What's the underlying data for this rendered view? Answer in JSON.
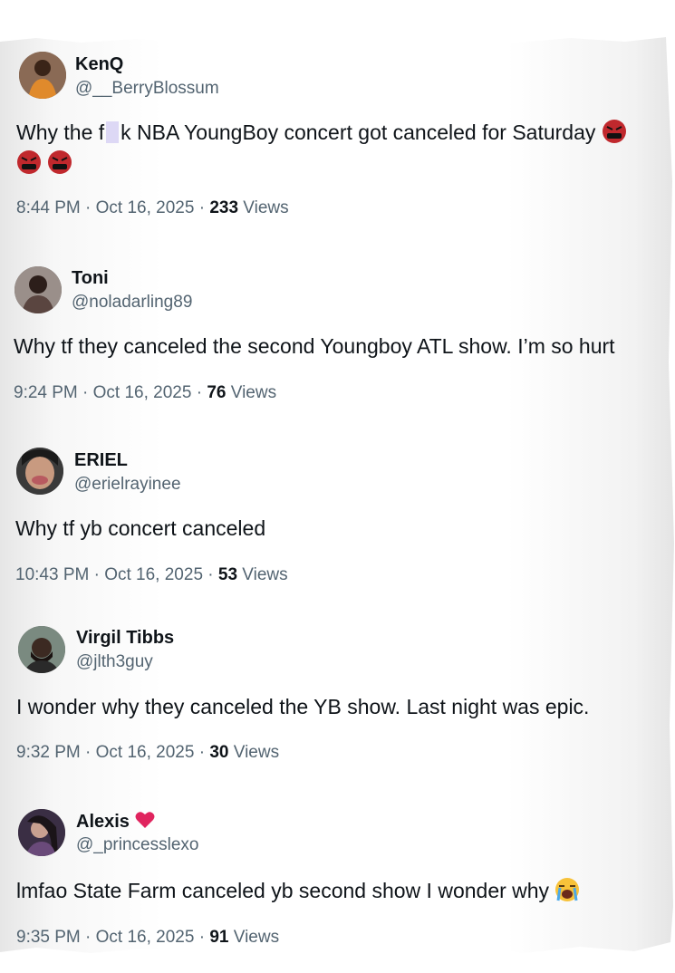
{
  "tweets": [
    {
      "name": "KenQ",
      "handle": "@__BerryBlossum",
      "text_a": "Why the f",
      "text_b": "k NBA YoungBoy concert got canceled for Saturday",
      "time": "8:44 PM · Oct 16, 2025 · ",
      "views": "233",
      "views_label": " Views",
      "emoji": "angry-cursing-face-icon"
    },
    {
      "name": "Toni",
      "handle": "@noladarling89",
      "text": "Why tf they canceled the second Youngboy ATL show. I’m so hurt",
      "time": "9:24 PM · Oct 16, 2025 · ",
      "views": "76",
      "views_label": " Views"
    },
    {
      "name": "ERIEL",
      "handle": "@erielrayinee",
      "text": "Why tf yb concert canceled",
      "time": "10:43 PM · Oct 16, 2025 · ",
      "views": "53",
      "views_label": " Views"
    },
    {
      "name": "Virgil Tibbs",
      "handle": "@jlth3guy",
      "text": "I wonder why they canceled the YB show. Last night was epic.",
      "time": "9:32 PM · Oct 16, 2025 · ",
      "views": "30",
      "views_label": " Views"
    },
    {
      "name": "Alexis",
      "handle": "@_princesslexo",
      "text": "lmfao State Farm canceled yb second show I wonder why",
      "time": "9:35 PM · Oct 16, 2025 · ",
      "views": "91",
      "views_label": " Views",
      "emoji": "loudly-crying-face-icon"
    }
  ],
  "colors": {
    "name": "#0f1419",
    "secondary": "#536471",
    "heart": "#e0245e",
    "angry": "#c0282d"
  }
}
